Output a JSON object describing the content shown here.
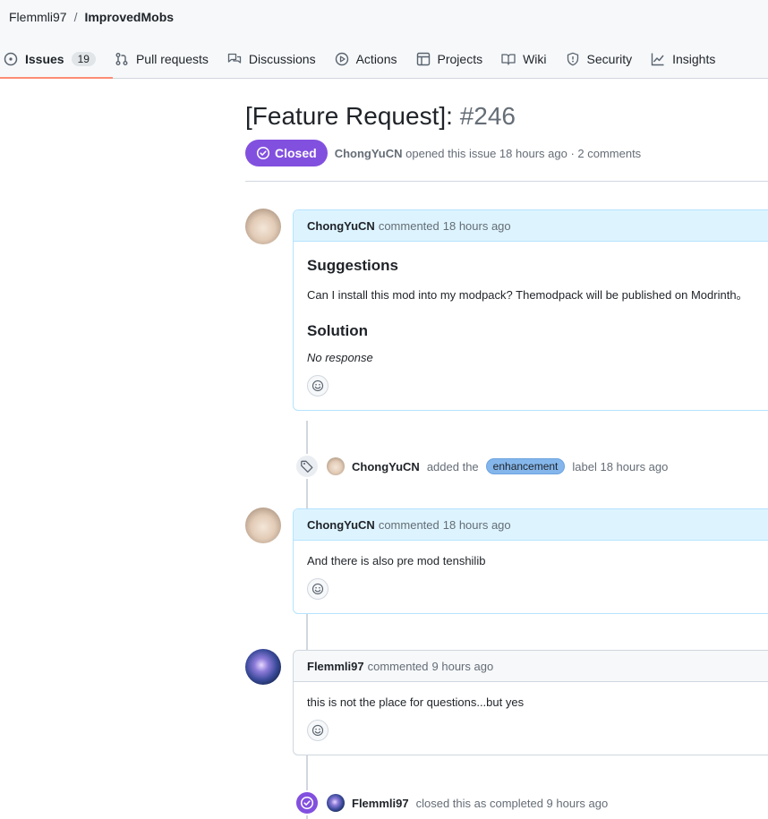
{
  "breadcrumb": {
    "owner": "Flemmli97",
    "separator": "/",
    "repo": "ImprovedMobs"
  },
  "tabs": [
    {
      "label": "Issues",
      "icon": "issue-opened-icon",
      "count": "19",
      "selected": true
    },
    {
      "label": "Pull requests",
      "icon": "git-pull-request-icon"
    },
    {
      "label": "Discussions",
      "icon": "comment-discussion-icon"
    },
    {
      "label": "Actions",
      "icon": "play-icon"
    },
    {
      "label": "Projects",
      "icon": "table-icon"
    },
    {
      "label": "Wiki",
      "icon": "book-icon"
    },
    {
      "label": "Security",
      "icon": "shield-icon"
    },
    {
      "label": "Insights",
      "icon": "graph-icon"
    }
  ],
  "issue": {
    "title": "[Feature Request]:",
    "number": "#246",
    "state": "Closed",
    "author": "ChongYuCN",
    "meta_text": "opened this issue 18 hours ago · 2 comments"
  },
  "comments": [
    {
      "author": "ChongYuCN",
      "action": "commented",
      "time": "18 hours ago",
      "heading1": "Suggestions",
      "text1": "Can I install this mod into my modpack? Themodpack will be published on Modrinth。",
      "heading2": "Solution",
      "text2": "No response"
    },
    {
      "author": "ChongYuCN",
      "action": "commented",
      "time": "18 hours ago",
      "text": "And there is also pre mod tenshilib"
    },
    {
      "author": "Flemmli97",
      "action": "commented",
      "time": "9 hours ago",
      "text": "this is not the place for questions...but yes"
    }
  ],
  "events": {
    "label": {
      "actor": "ChongYuCN",
      "before": "added the",
      "label_name": "enhancement",
      "after": "label 18 hours ago",
      "icon": "tag-icon"
    },
    "closed": {
      "actor": "Flemmli97",
      "text": "closed this as completed 9 hours ago",
      "icon": "check-circle-icon"
    }
  },
  "colors": {
    "closed_purple": "#8250df",
    "author_header_bg": "#ddf4ff",
    "tab_underline": "#fd8c73",
    "label_bg": "#84b6eb"
  }
}
